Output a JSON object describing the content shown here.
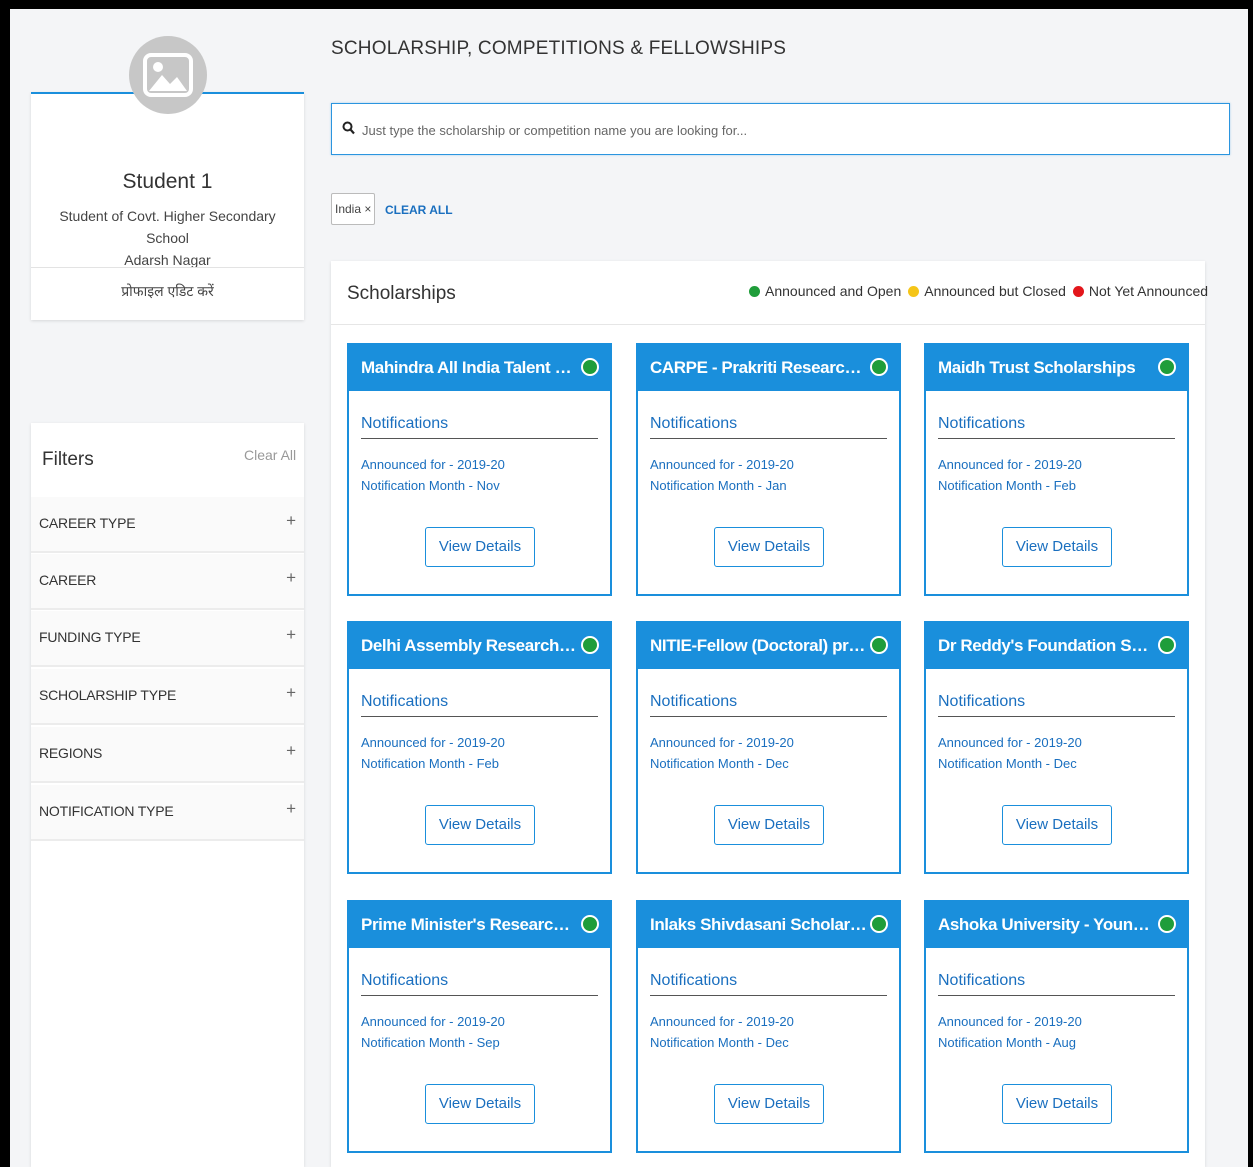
{
  "profile": {
    "name": "Student 1",
    "school_line1": "Student of Covt. Higher Secondary School",
    "school_line2": "Adarsh Nagar",
    "edit_label": "प्रोफाइल एडिट करें"
  },
  "filters": {
    "title": "Filters",
    "clear_all": "Clear All",
    "items": [
      {
        "label": "CAREER TYPE",
        "icon": "+"
      },
      {
        "label": "CAREER",
        "icon": "+"
      },
      {
        "label": "FUNDING TYPE",
        "icon": "+"
      },
      {
        "label": "SCHOLARSHIP TYPE",
        "icon": "+"
      },
      {
        "label": "REGIONS",
        "icon": "+"
      },
      {
        "label": "NOTIFICATION TYPE",
        "icon": "+"
      }
    ]
  },
  "main": {
    "title": "SCHOLARSHIP, COMPETITIONS & FELLOWSHIPS",
    "search_placeholder": "Just type the scholarship or competition name you are looking for...",
    "chip_label": "India ×",
    "clear_all": "CLEAR ALL"
  },
  "results": {
    "title": "Scholarships",
    "legend": [
      {
        "label": "Announced and Open",
        "color": "#1f9d3a"
      },
      {
        "label": "Announced but Closed",
        "color": "#f5c518"
      },
      {
        "label": "Not Yet Announced",
        "color": "#e3161b"
      }
    ],
    "cards": [
      {
        "title": "Mahindra All India Talent Sch...",
        "notifications": "Notifications",
        "announced": "Announced for - 2019-20",
        "month": "Notification Month - Nov",
        "button": "View Details",
        "status_color": "#1f9d3a"
      },
      {
        "title": "CARPE - Prakriti Research Fell...",
        "notifications": "Notifications",
        "announced": "Announced for - 2019-20",
        "month": "Notification Month - Jan",
        "button": "View Details",
        "status_color": "#1f9d3a"
      },
      {
        "title": "Maidh Trust Scholarships",
        "notifications": "Notifications",
        "announced": "Announced for - 2019-20",
        "month": "Notification Month - Feb",
        "button": "View Details",
        "status_color": "#1f9d3a"
      },
      {
        "title": "Delhi Assembly Research Cent...",
        "notifications": "Notifications",
        "announced": "Announced for - 2019-20",
        "month": "Notification Month - Feb",
        "button": "View Details",
        "status_color": "#1f9d3a"
      },
      {
        "title": "NITIE-Fellow (Doctoral) progra...",
        "notifications": "Notifications",
        "announced": "Announced for - 2019-20",
        "month": "Notification Month - Dec",
        "button": "View Details",
        "status_color": "#1f9d3a"
      },
      {
        "title": "Dr Reddy's Foundation Sashak...",
        "notifications": "Notifications",
        "announced": "Announced for - 2019-20",
        "month": "Notification Month - Dec",
        "button": "View Details",
        "status_color": "#1f9d3a"
      },
      {
        "title": "Prime Minister's Research Fell...",
        "notifications": "Notifications",
        "announced": "Announced for - 2019-20",
        "month": "Notification Month - Sep",
        "button": "View Details",
        "status_color": "#1f9d3a"
      },
      {
        "title": "Inlaks Shivdasani Scholarships",
        "notifications": "Notifications",
        "announced": "Announced for - 2019-20",
        "month": "Notification Month - Dec",
        "button": "View Details",
        "status_color": "#1f9d3a"
      },
      {
        "title": "Ashoka University - Young Indi...",
        "notifications": "Notifications",
        "announced": "Announced for - 2019-20",
        "month": "Notification Month - Aug",
        "button": "View Details",
        "status_color": "#1f9d3a"
      }
    ]
  }
}
